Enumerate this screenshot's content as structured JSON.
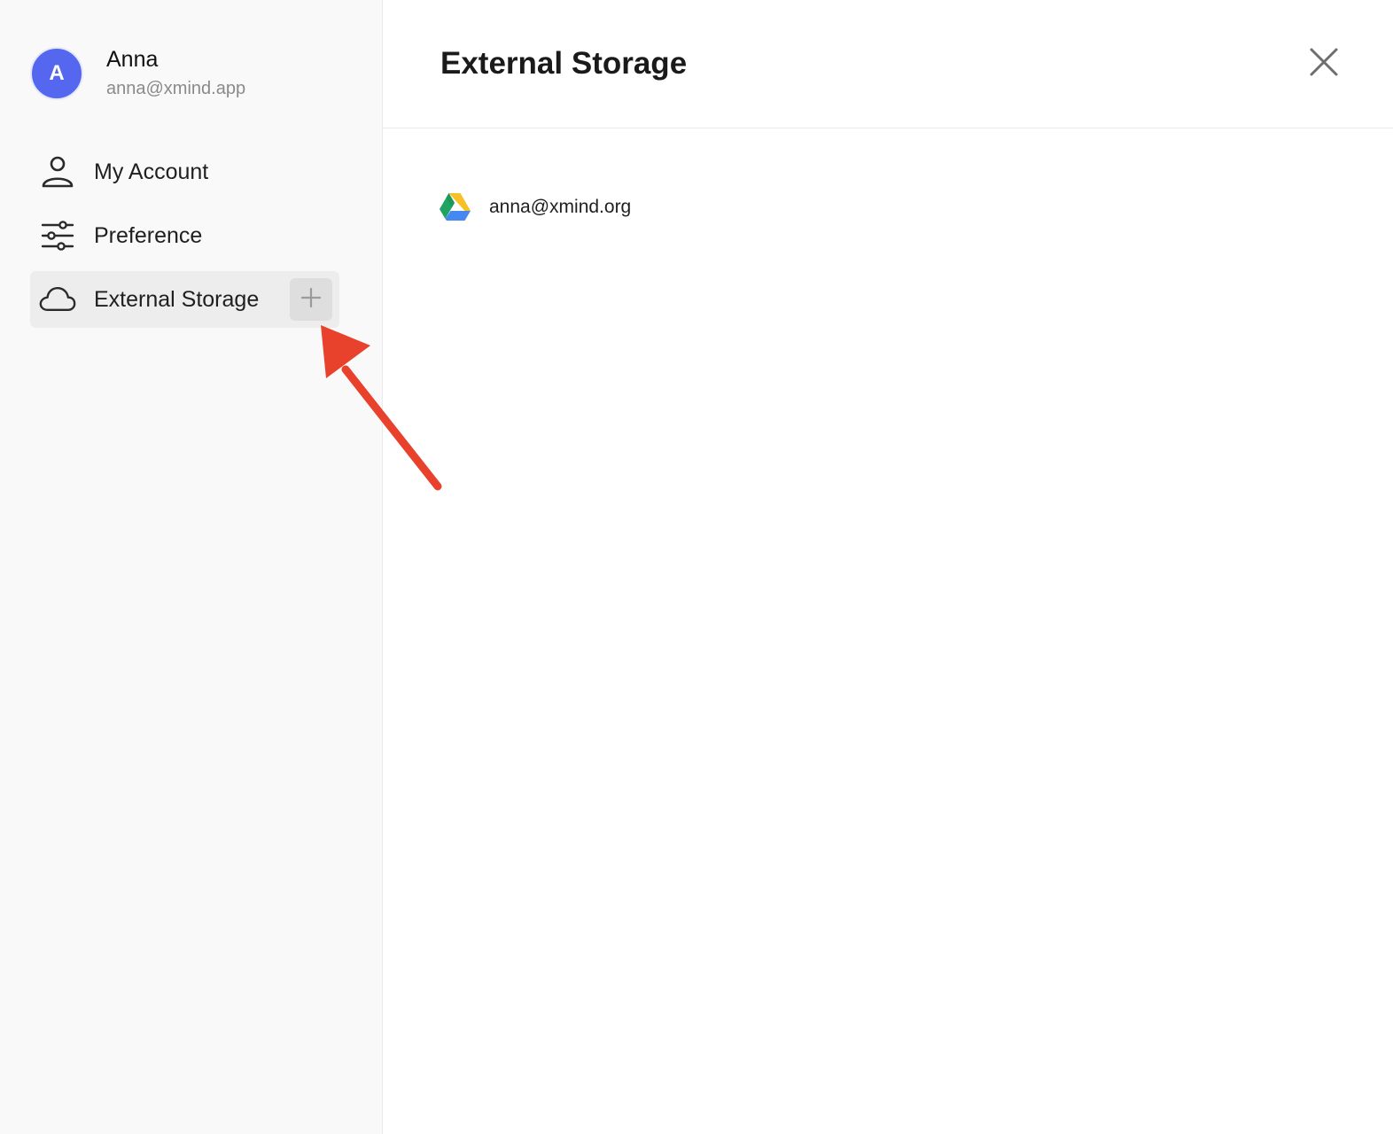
{
  "user": {
    "initial": "A",
    "name": "Anna",
    "email": "anna@xmind.app",
    "avatar_color": "#5567ee"
  },
  "sidebar": {
    "items": [
      {
        "label": "My Account",
        "icon": "person-icon",
        "active": false
      },
      {
        "label": "Preference",
        "icon": "sliders-icon",
        "active": false
      },
      {
        "label": "External Storage",
        "icon": "cloud-icon",
        "active": true,
        "action_icon": "plus-icon"
      }
    ]
  },
  "main": {
    "title": "External Storage",
    "close_icon": "close-icon",
    "storage_accounts": [
      {
        "provider_icon": "google-drive-icon",
        "email": "anna@xmind.org"
      }
    ]
  },
  "annotation": {
    "arrow_color": "#e8412c",
    "points_to": "add-storage-button"
  }
}
